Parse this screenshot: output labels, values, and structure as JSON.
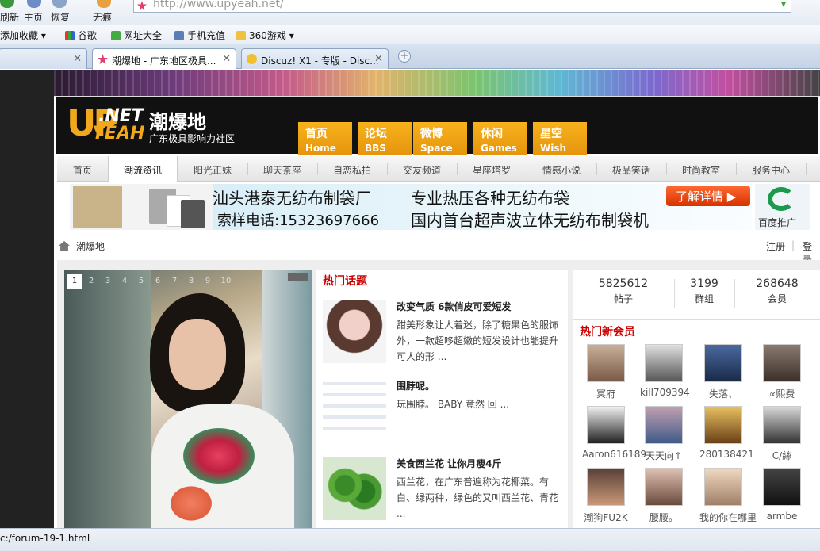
{
  "browser": {
    "nav_buttons": [
      "刷新",
      "主页",
      "恢复",
      "无痕"
    ],
    "address_url": "http://www.upyeah.net/",
    "bookmarks": [
      "添加收藏",
      "谷歌",
      "网址大全",
      "手机充值",
      "360游戏"
    ],
    "tabs": [
      {
        "label": ""
      },
      {
        "label": "潮爆地 - 广东地区极具..."
      },
      {
        "label": "Discuz! X1 - 专版 - Disc..."
      }
    ],
    "new_tab_symbol": "+",
    "status_text": "c:/forum-19-1.html"
  },
  "site": {
    "logo_up": "UP",
    "logo_net": ".NET",
    "logo_yeah": "YEAH",
    "logo_cn": "潮爆地",
    "logo_sub": "广东极具影响力社区",
    "header_nav": [
      {
        "cn": "首页",
        "en": "Home"
      },
      {
        "cn": "论坛",
        "en": "BBS"
      },
      {
        "cn": "微博",
        "en": "Space"
      },
      {
        "cn": "休闲",
        "en": "Games"
      },
      {
        "cn": "星空",
        "en": "Wish"
      }
    ],
    "sub_nav": [
      "首页",
      "潮流资讯",
      "阳光正妹",
      "聊天茶座",
      "自恋私拍",
      "交友频道",
      "星座塔罗",
      "情感小说",
      "极品笑话",
      "时尚教室",
      "服务中心"
    ],
    "sub_nav_active": 1
  },
  "ad": {
    "line1a": "汕头港泰无纺布制袋厂",
    "line1b": "专业热压各种无纺布袋",
    "line2a": "索样电话:15323697666",
    "line2b": "国内首台超声波立体无纺布制袋机",
    "button": "了解详情 ▶",
    "logo_text": "百度推广"
  },
  "breadcrumb": {
    "home": "潮爆地",
    "register": "注册",
    "login": "登录"
  },
  "slideshow": {
    "numbers": [
      "1",
      "2",
      "3",
      "4",
      "5",
      "6",
      "7",
      "8",
      "9",
      "10"
    ],
    "active": 0
  },
  "hot_topics": {
    "title": "热门话题",
    "articles": [
      {
        "title": "改变气质 6款俏皮可爱短发",
        "desc": "甜美形象让人着迷，除了糖果色的服饰外，一款超哆超嫩的短发设计也能提升可人的形 ..."
      },
      {
        "title": "围脖呢。",
        "desc": "玩围脖。 BABY 竟然 回 ..."
      },
      {
        "title": "美食西兰花 让你月瘦4斤",
        "desc": "西兰花，在广东普遍称为花椰菜。有白、绿两种，绿色的又叫西兰花、青花 ..."
      }
    ]
  },
  "stats": [
    {
      "value": "5825612",
      "label": "帖子"
    },
    {
      "value": "3199",
      "label": "群组"
    },
    {
      "value": "268648",
      "label": "会员"
    }
  ],
  "new_members": {
    "title": "热门新会员",
    "members": [
      "冥府",
      "kill709394",
      "失落、",
      "∝熙费",
      "Aaron616189",
      "天天向↑",
      "280138421",
      "C/絲",
      "潮狗FU2K",
      "腰腰。",
      "我的你在哪里",
      "armbe"
    ]
  }
}
